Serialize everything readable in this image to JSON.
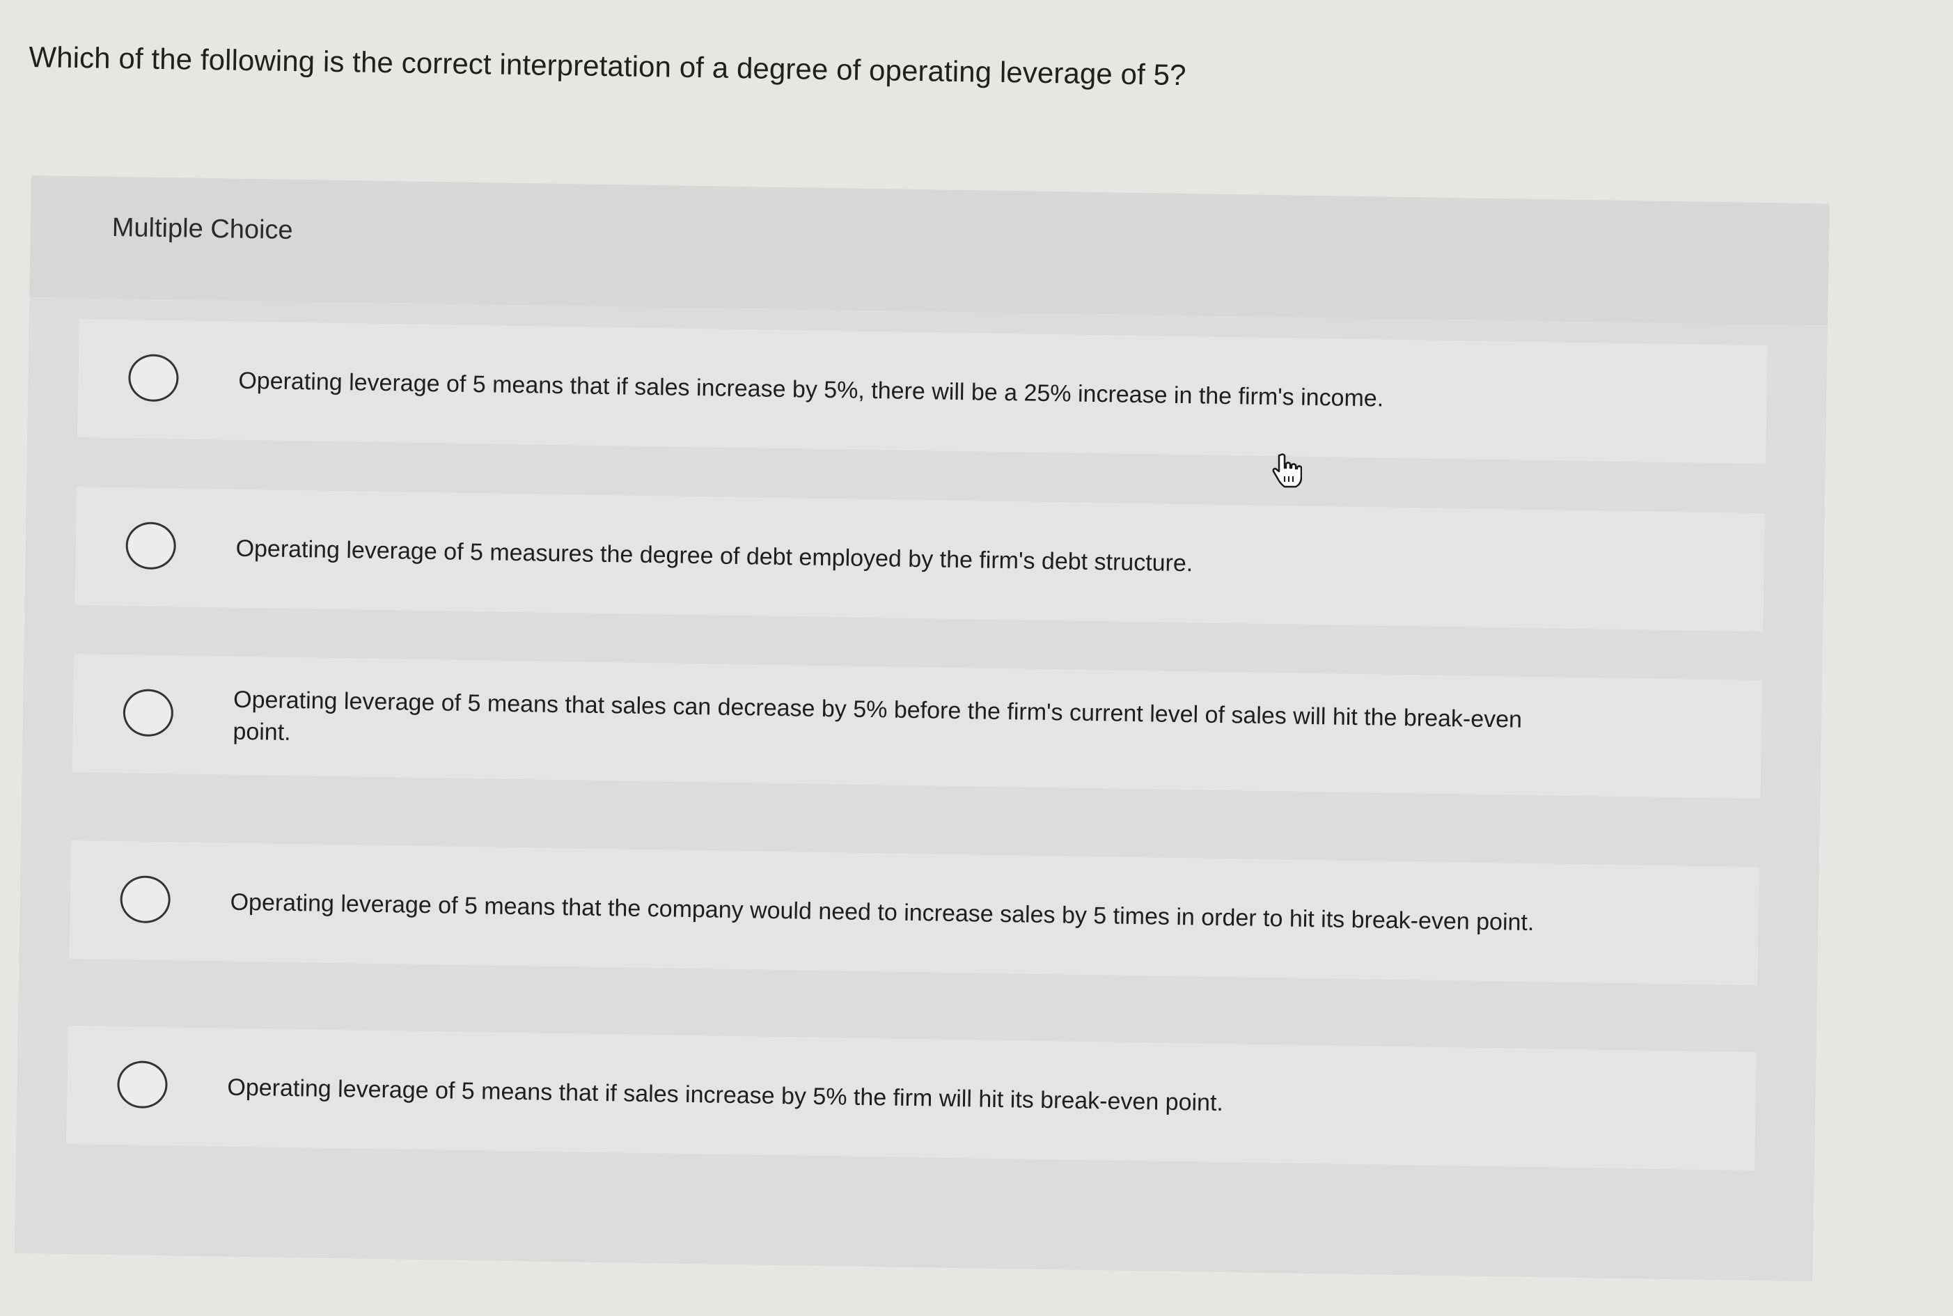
{
  "question": {
    "text": "Which of the following is the correct interpretation of a degree of operating leverage of 5?"
  },
  "panel": {
    "title": "Multiple Choice",
    "options": [
      {
        "label": "Operating leverage of 5 means that if sales increase by 5%, there will be a 25% increase in the firm's income."
      },
      {
        "label": "Operating leverage of 5 measures the degree of debt employed by the firm's debt structure."
      },
      {
        "label": "Operating leverage of 5 means that sales can decrease by 5% before the firm's current level of sales will hit the break-even point."
      },
      {
        "label": "Operating leverage of 5 means that the company would need to increase sales by 5 times in order to hit its break-even point."
      },
      {
        "label": "Operating leverage of 5 means that if sales increase by 5% the firm will hit its break-even point."
      }
    ]
  },
  "cursor": {
    "icon": "hand-pointer-icon"
  },
  "colors": {
    "background": "#e6e6e5",
    "panel": "#dcdcdc",
    "option": "#e4e4e4",
    "text": "#1f1f1f"
  }
}
